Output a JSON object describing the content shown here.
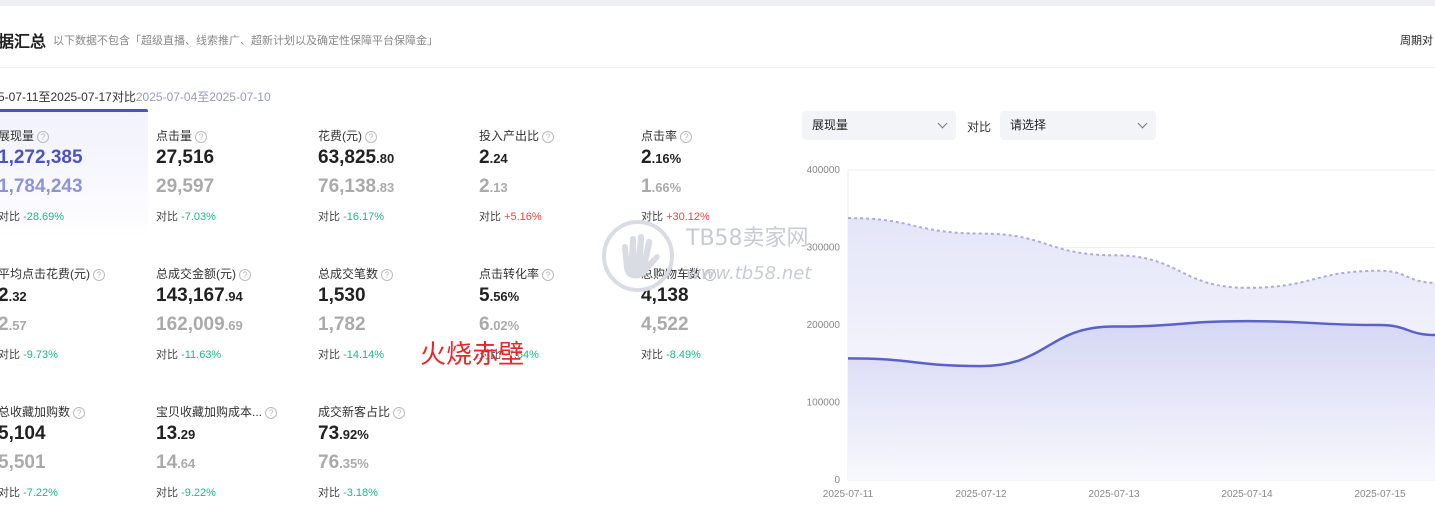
{
  "header": {
    "title": "据汇总",
    "subtitle": "以下数据不包含「超级直播、线索推广、超新计划以及确定性保障平台保障金」",
    "right_link": "周期对"
  },
  "date_range": {
    "current": "5-07-11至2025-07-17",
    "compare_label": "对比",
    "compare": "2025-07-04至2025-07-10"
  },
  "metrics": [
    {
      "label": "展现量",
      "main_int": "1,272,385",
      "main_dec": "",
      "cmp_int": "1,784,243",
      "cmp_dec": "",
      "diff_label": "对比",
      "diff": "-28.69%",
      "dir": "down"
    },
    {
      "label": "点击量",
      "main_int": "27,516",
      "main_dec": "",
      "cmp_int": "29,597",
      "cmp_dec": "",
      "diff_label": "对比",
      "diff": "-7.03%",
      "dir": "down"
    },
    {
      "label": "花费(元)",
      "main_int": "63,825",
      "main_dec": ".80",
      "cmp_int": "76,138",
      "cmp_dec": ".83",
      "diff_label": "对比",
      "diff": "-16.17%",
      "dir": "down"
    },
    {
      "label": "投入产出比",
      "main_int": "2",
      "main_dec": ".24",
      "cmp_int": "2",
      "cmp_dec": ".13",
      "diff_label": "对比",
      "diff": "+5.16%",
      "dir": "up"
    },
    {
      "label": "点击率",
      "main_int": "2",
      "main_dec": ".16%",
      "cmp_int": "1",
      "cmp_dec": ".66%",
      "diff_label": "对比",
      "diff": "+30.12%",
      "dir": "up"
    },
    {
      "label": "平均点击花费(元)",
      "main_int": "2",
      "main_dec": ".32",
      "cmp_int": "2",
      "cmp_dec": ".57",
      "diff_label": "对比",
      "diff": "-9.73%",
      "dir": "down"
    },
    {
      "label": "总成交金额(元)",
      "main_int": "143,167",
      "main_dec": ".94",
      "cmp_int": "162,009",
      "cmp_dec": ".69",
      "diff_label": "对比",
      "diff": "-11.63%",
      "dir": "down"
    },
    {
      "label": "总成交笔数",
      "main_int": "1,530",
      "main_dec": "",
      "cmp_int": "1,782",
      "cmp_dec": "",
      "diff_label": "对比",
      "diff": "-14.14%",
      "dir": "down"
    },
    {
      "label": "点击转化率",
      "main_int": "5",
      "main_dec": ".56%",
      "cmp_int": "6",
      "cmp_dec": ".02%",
      "diff_label": "对比",
      "diff": "-7.64%",
      "dir": "down"
    },
    {
      "label": "总购物车数",
      "main_int": "4,138",
      "main_dec": "",
      "cmp_int": "4,522",
      "cmp_dec": "",
      "diff_label": "对比",
      "diff": "-8.49%",
      "dir": "down"
    },
    {
      "label": "总收藏加购数",
      "main_int": "5,104",
      "main_dec": "",
      "cmp_int": "5,501",
      "cmp_dec": "",
      "diff_label": "对比",
      "diff": "-7.22%",
      "dir": "down"
    },
    {
      "label": "宝贝收藏加购成本...",
      "main_int": "13",
      "main_dec": ".29",
      "cmp_int": "14",
      "cmp_dec": ".64",
      "diff_label": "对比",
      "diff": "-9.22%",
      "dir": "down"
    },
    {
      "label": "成交新客占比",
      "main_int": "73",
      "main_dec": ".92%",
      "cmp_int": "76",
      "cmp_dec": ".35%",
      "diff_label": "对比",
      "diff": "-3.18%",
      "dir": "down"
    }
  ],
  "controls": {
    "metric_select": "展现量",
    "compare_label": "对比",
    "compare_select": "请选择"
  },
  "watermark": {
    "brand": "TB58卖家网",
    "url": "www.tb58.net",
    "stamp": "火烧赤壁"
  },
  "colors": {
    "accent": "#4b52c6",
    "down": "#1fb58a",
    "up": "#e64545"
  },
  "chart_data": {
    "type": "area",
    "x": [
      "2025-07-11",
      "2025-07-12",
      "2025-07-13",
      "2025-07-14",
      "2025-07-15"
    ],
    "y_ticks": [
      "400000",
      "300000",
      "200000",
      "100000",
      "0"
    ],
    "ylim": [
      0,
      400000
    ],
    "series": [
      {
        "style": "solid",
        "values": [
          157000,
          147000,
          198000,
          205000,
          200000
        ]
      },
      {
        "style": "dashed",
        "values": [
          338000,
          318000,
          290000,
          248000,
          270000
        ]
      }
    ],
    "grid": "horizontal"
  }
}
